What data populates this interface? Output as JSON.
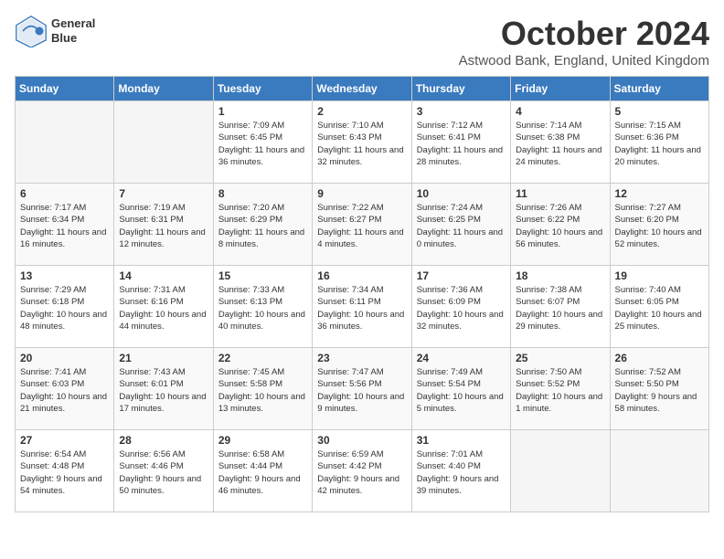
{
  "header": {
    "logo_line1": "General",
    "logo_line2": "Blue",
    "month": "October 2024",
    "location": "Astwood Bank, England, United Kingdom"
  },
  "weekdays": [
    "Sunday",
    "Monday",
    "Tuesday",
    "Wednesday",
    "Thursday",
    "Friday",
    "Saturday"
  ],
  "weeks": [
    [
      {
        "day": "",
        "info": ""
      },
      {
        "day": "",
        "info": ""
      },
      {
        "day": "1",
        "info": "Sunrise: 7:09 AM\nSunset: 6:45 PM\nDaylight: 11 hours and 36 minutes."
      },
      {
        "day": "2",
        "info": "Sunrise: 7:10 AM\nSunset: 6:43 PM\nDaylight: 11 hours and 32 minutes."
      },
      {
        "day": "3",
        "info": "Sunrise: 7:12 AM\nSunset: 6:41 PM\nDaylight: 11 hours and 28 minutes."
      },
      {
        "day": "4",
        "info": "Sunrise: 7:14 AM\nSunset: 6:38 PM\nDaylight: 11 hours and 24 minutes."
      },
      {
        "day": "5",
        "info": "Sunrise: 7:15 AM\nSunset: 6:36 PM\nDaylight: 11 hours and 20 minutes."
      }
    ],
    [
      {
        "day": "6",
        "info": "Sunrise: 7:17 AM\nSunset: 6:34 PM\nDaylight: 11 hours and 16 minutes."
      },
      {
        "day": "7",
        "info": "Sunrise: 7:19 AM\nSunset: 6:31 PM\nDaylight: 11 hours and 12 minutes."
      },
      {
        "day": "8",
        "info": "Sunrise: 7:20 AM\nSunset: 6:29 PM\nDaylight: 11 hours and 8 minutes."
      },
      {
        "day": "9",
        "info": "Sunrise: 7:22 AM\nSunset: 6:27 PM\nDaylight: 11 hours and 4 minutes."
      },
      {
        "day": "10",
        "info": "Sunrise: 7:24 AM\nSunset: 6:25 PM\nDaylight: 11 hours and 0 minutes."
      },
      {
        "day": "11",
        "info": "Sunrise: 7:26 AM\nSunset: 6:22 PM\nDaylight: 10 hours and 56 minutes."
      },
      {
        "day": "12",
        "info": "Sunrise: 7:27 AM\nSunset: 6:20 PM\nDaylight: 10 hours and 52 minutes."
      }
    ],
    [
      {
        "day": "13",
        "info": "Sunrise: 7:29 AM\nSunset: 6:18 PM\nDaylight: 10 hours and 48 minutes."
      },
      {
        "day": "14",
        "info": "Sunrise: 7:31 AM\nSunset: 6:16 PM\nDaylight: 10 hours and 44 minutes."
      },
      {
        "day": "15",
        "info": "Sunrise: 7:33 AM\nSunset: 6:13 PM\nDaylight: 10 hours and 40 minutes."
      },
      {
        "day": "16",
        "info": "Sunrise: 7:34 AM\nSunset: 6:11 PM\nDaylight: 10 hours and 36 minutes."
      },
      {
        "day": "17",
        "info": "Sunrise: 7:36 AM\nSunset: 6:09 PM\nDaylight: 10 hours and 32 minutes."
      },
      {
        "day": "18",
        "info": "Sunrise: 7:38 AM\nSunset: 6:07 PM\nDaylight: 10 hours and 29 minutes."
      },
      {
        "day": "19",
        "info": "Sunrise: 7:40 AM\nSunset: 6:05 PM\nDaylight: 10 hours and 25 minutes."
      }
    ],
    [
      {
        "day": "20",
        "info": "Sunrise: 7:41 AM\nSunset: 6:03 PM\nDaylight: 10 hours and 21 minutes."
      },
      {
        "day": "21",
        "info": "Sunrise: 7:43 AM\nSunset: 6:01 PM\nDaylight: 10 hours and 17 minutes."
      },
      {
        "day": "22",
        "info": "Sunrise: 7:45 AM\nSunset: 5:58 PM\nDaylight: 10 hours and 13 minutes."
      },
      {
        "day": "23",
        "info": "Sunrise: 7:47 AM\nSunset: 5:56 PM\nDaylight: 10 hours and 9 minutes."
      },
      {
        "day": "24",
        "info": "Sunrise: 7:49 AM\nSunset: 5:54 PM\nDaylight: 10 hours and 5 minutes."
      },
      {
        "day": "25",
        "info": "Sunrise: 7:50 AM\nSunset: 5:52 PM\nDaylight: 10 hours and 1 minute."
      },
      {
        "day": "26",
        "info": "Sunrise: 7:52 AM\nSunset: 5:50 PM\nDaylight: 9 hours and 58 minutes."
      }
    ],
    [
      {
        "day": "27",
        "info": "Sunrise: 6:54 AM\nSunset: 4:48 PM\nDaylight: 9 hours and 54 minutes."
      },
      {
        "day": "28",
        "info": "Sunrise: 6:56 AM\nSunset: 4:46 PM\nDaylight: 9 hours and 50 minutes."
      },
      {
        "day": "29",
        "info": "Sunrise: 6:58 AM\nSunset: 4:44 PM\nDaylight: 9 hours and 46 minutes."
      },
      {
        "day": "30",
        "info": "Sunrise: 6:59 AM\nSunset: 4:42 PM\nDaylight: 9 hours and 42 minutes."
      },
      {
        "day": "31",
        "info": "Sunrise: 7:01 AM\nSunset: 4:40 PM\nDaylight: 9 hours and 39 minutes."
      },
      {
        "day": "",
        "info": ""
      },
      {
        "day": "",
        "info": ""
      }
    ]
  ]
}
